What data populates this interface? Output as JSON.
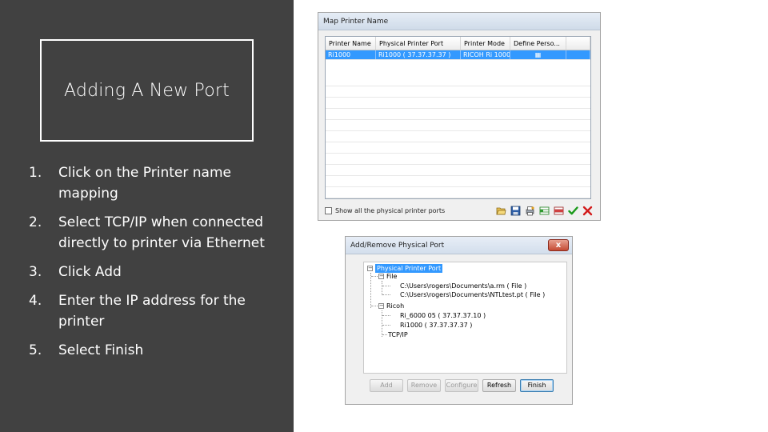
{
  "slide": {
    "title": "Adding A New Port",
    "steps": [
      {
        "num": "1.",
        "text": "Click on the Printer name mapping"
      },
      {
        "num": "2.",
        "text": "Select TCP/IP when connected directly to printer via Ethernet"
      },
      {
        "num": "3.",
        "text": "Click Add"
      },
      {
        "num": "4.",
        "text": "Enter the IP address for the printer"
      },
      {
        "num": "5.",
        "text": "Select Finish"
      }
    ]
  },
  "map_dialog": {
    "title": "Map Printer Name",
    "columns": [
      "Printer Name",
      "Physical Printer Port",
      "Printer Mode",
      "Define Perso..."
    ],
    "rows": [
      {
        "name": "Ri1000",
        "port": "Ri1000 ( 37.37.37.37 )",
        "mode": "RICOH Ri 1000",
        "define": "▦"
      }
    ],
    "show_label": "Show all the physical printer ports",
    "icons": [
      "open-folder-icon",
      "save-icon",
      "printer-settings-icon",
      "add-row-icon",
      "delete-row-icon",
      "checkmark-icon",
      "close-x-icon"
    ],
    "colors": {
      "selection": "#3399ff",
      "check": "#1a9a1a",
      "cross": "#d21a1a"
    }
  },
  "port_dialog": {
    "title": "Add/Remove Physical Port",
    "close_label": "x",
    "tree": {
      "root": "Physical Printer Port",
      "file_group": "File",
      "file_items": [
        "C:\\Users\\rogers\\Documents\\a.rm ( File )",
        "C:\\Users\\rogers\\Documents\\NTLtest.pt ( File )"
      ],
      "ricoh_group": "Ricoh",
      "ricoh_items": [
        "Ri_6000 05 ( 37.37.37.10 )",
        "Ri1000 ( 37.37.37.37 )"
      ],
      "tcp": "TCP/IP"
    },
    "buttons": {
      "add": "Add",
      "remove": "Remove",
      "configure": "Configure",
      "refresh": "Refresh",
      "finish": "Finish"
    }
  }
}
